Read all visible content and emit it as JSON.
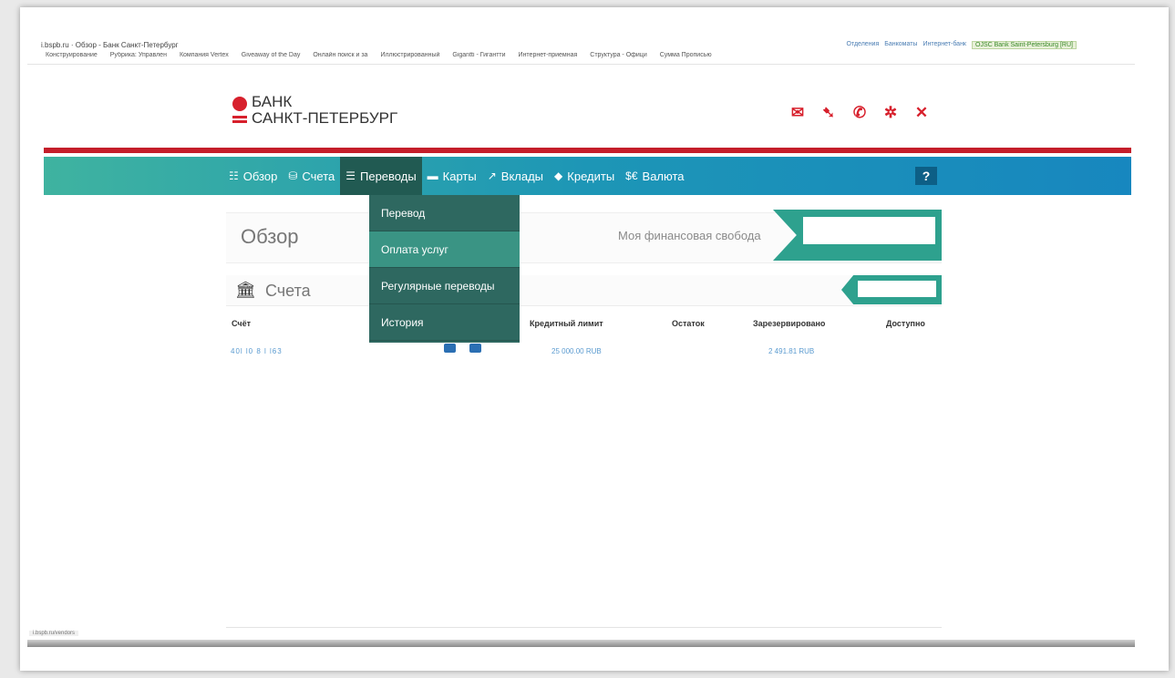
{
  "browser": {
    "tab_title": "Обзор - Банк Санкт-Петербург",
    "url": "i.bspb.ru",
    "links": [
      "Отделения",
      "Банкоматы",
      "Интернет-банк"
    ],
    "site_badge": "OJSC Bank Saint-Petersburg [RU]",
    "bookmarks": [
      "Конструирование",
      "Рубрика: Управлен",
      "Компания Vertex",
      "Giveaway of the Day",
      "Онлайн поиск и за",
      "Иллюстрированный",
      "Gigantti - Гигантти",
      "Интернет-приемная",
      "Структура - Офици",
      "Сумма Прописью"
    ],
    "status_url": "i.bspb.ru/vendors"
  },
  "header": {
    "logo_line1": "БАНК",
    "logo_line2": "САНКТ-ПЕТЕРБУРГ",
    "icons": [
      "mail-icon",
      "rocket-icon",
      "phone-icon",
      "gear-icon",
      "close-icon"
    ]
  },
  "nav": {
    "items": [
      {
        "label": "Обзор",
        "icon": "overview-icon"
      },
      {
        "label": "Счета",
        "icon": "accounts-icon"
      },
      {
        "label": "Переводы",
        "icon": "transfers-icon"
      },
      {
        "label": "Карты",
        "icon": "cards-icon"
      },
      {
        "label": "Вклады",
        "icon": "deposits-icon"
      },
      {
        "label": "Кредиты",
        "icon": "credits-icon"
      },
      {
        "label": "Валюта",
        "icon": "currency-icon"
      }
    ],
    "help": "?"
  },
  "dropdown": {
    "items": [
      "Перевод",
      "Оплата услуг",
      "Регулярные переводы",
      "История"
    ]
  },
  "overview": {
    "title": "Обзор",
    "freedom_label": "Моя финансовая свобода"
  },
  "accounts": {
    "title": "Счета",
    "columns": [
      "Счёт",
      "Кредитный лимит",
      "Остаток",
      "Зарезервировано",
      "Доступно"
    ],
    "rows": [
      {
        "account": "40l   l0 8 l   l63",
        "credit_limit": "25 000.00 RUB",
        "reserved": "2 491.81 RUB"
      }
    ]
  }
}
